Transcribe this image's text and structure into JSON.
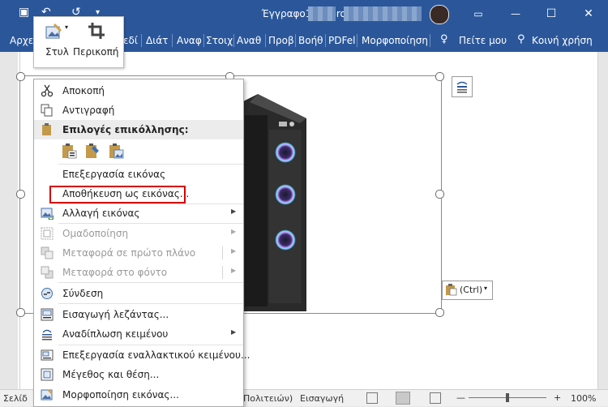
{
  "titlebar": {
    "title": "Έγγραφο1 - Word",
    "redo_glyph": "↺",
    "undo_glyph": "↶",
    "save_glyph": "▣",
    "qa_more": "▾",
    "minimize": "—",
    "maximize": "☐",
    "close": "✕",
    "ribbon_opt": "▭",
    "color": "#2b579a"
  },
  "ribbon": {
    "tabs": [
      "Αρχε",
      "εδί",
      "Διάτ",
      "Αναφ",
      "Στοιχ",
      "Αναθ",
      "Προβ",
      "Βοήθ",
      "PDFel",
      "Μορφοποίηση",
      "Πείτε μου",
      "Κοινή χρήση"
    ],
    "lightbulb_glyph": "♀",
    "person_glyph": "⚲"
  },
  "mini_toolbar": {
    "style_label": "Στυλ",
    "crop_label": "Περικοπή",
    "style_arrow": "▾"
  },
  "context_menu": {
    "items": [
      {
        "label": "Αποκοπή",
        "disabled": false
      },
      {
        "label": "Αντιγραφή",
        "disabled": false
      },
      {
        "label": "Επιλογές επικόλλησης:",
        "disabled": false
      },
      {
        "label": "Επεξεργασία εικόνας",
        "disabled": true
      },
      {
        "label": "Αποθήκευση ως εικόνας...",
        "disabled": false
      },
      {
        "label": "Αλλαγή εικόνας",
        "disabled": false,
        "arrow": "▶"
      },
      {
        "label": "Ομαδοποίηση",
        "disabled": true,
        "arrow": "▶"
      },
      {
        "label": "Μεταφορά σε πρώτο πλάνο",
        "disabled": true,
        "arrow": "▶"
      },
      {
        "label": "Μεταφορά στο φόντο",
        "disabled": true,
        "arrow": "▶"
      },
      {
        "label": "Σύνδεση",
        "disabled": false
      },
      {
        "label": "Εισαγωγή λεζάντας...",
        "disabled": false
      },
      {
        "label": "Αναδίπλωση κειμένου",
        "disabled": false,
        "arrow": "▶"
      },
      {
        "label": "Επεξεργασία εναλλακτικού κειμένου...",
        "disabled": false
      },
      {
        "label": "Μέγεθος και θέση...",
        "disabled": false
      },
      {
        "label": "Μορφοποίηση εικόνας...",
        "disabled": false
      }
    ],
    "highlight_color": "#d60000"
  },
  "paste_ctrl": {
    "label": "(Ctrl)",
    "arrow": "▾"
  },
  "status": {
    "page_label": "Σελίδ",
    "lang_label": "Πολιτειών)",
    "insert_label": "Εισαγωγή",
    "zoom_minus": "—",
    "zoom_plus": "+",
    "zoom": "100%"
  }
}
